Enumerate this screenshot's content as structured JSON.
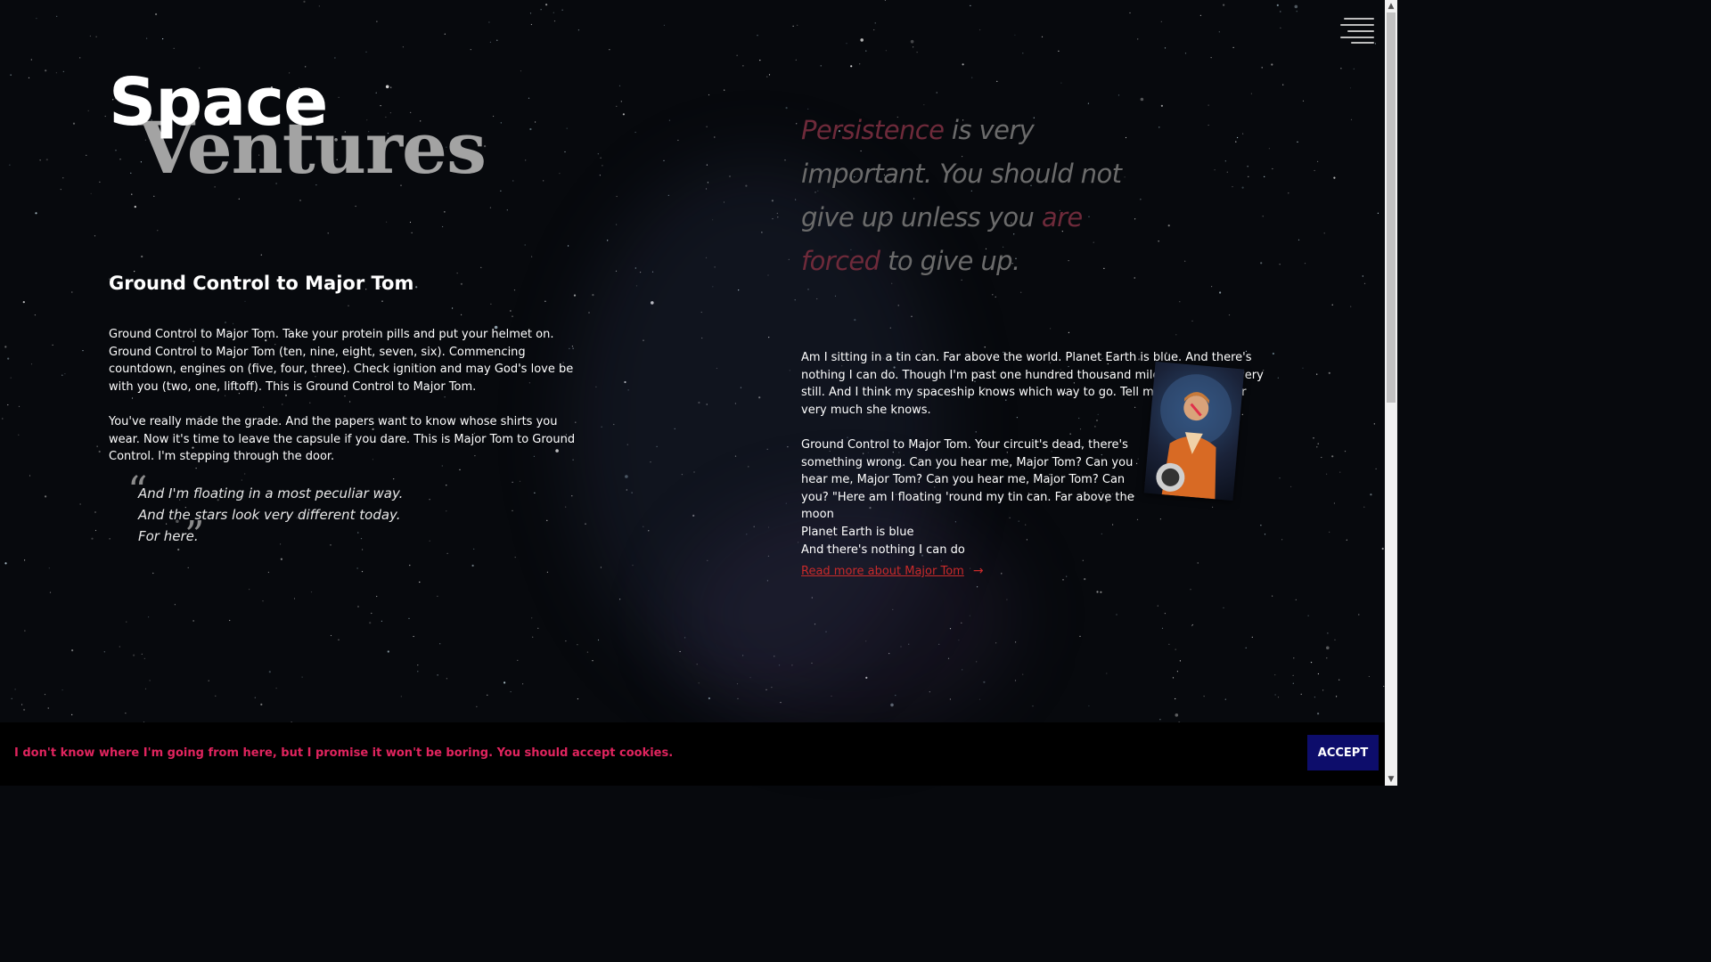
{
  "logo": {
    "word1": "Space",
    "word2": "Ventures"
  },
  "menu": {
    "icon": "hamburger-menu-icon"
  },
  "left": {
    "heading": "Ground Control to Major Tom",
    "paragraphs": [
      "Ground Control to Major Tom. Take your protein pills and put your helmet on. Ground Control to Major Tom (ten, nine, eight, seven, six). Commencing countdown, engines on (five, four, three). Check ignition and may God's love be with you (two, one, liftoff). This is Ground Control to Major Tom.",
      "You've really made the grade. And the papers want to know whose shirts you wear. Now it's time to leave the capsule if you dare. This is Major Tom to Ground Control. I'm stepping through the door."
    ],
    "quote": {
      "open_mark": "“",
      "close_mark": "”",
      "lines": [
        "And I'm floating in a most peculiar way.",
        "And the stars look very different today.",
        "For here."
      ]
    }
  },
  "right": {
    "big_quote": {
      "word1": "Persistence",
      "part2": " is very important. You should not give up unless you ",
      "word2": "are forced",
      "part3": " to give up."
    },
    "paragraph1": "Am I sitting in a tin can. Far above the world. Planet Earth is blue. And there's nothing I can do. Though I'm past one hundred thousand miles. I'm feeling very still. And I think my spaceship knows which way to go. Tell my wife I love her very much she knows.",
    "paragraph2": "Ground Control to Major Tom. Your circuit's dead, there's something wrong. Can you hear me, Major Tom? Can you hear me, Major Tom? Can you hear me, Major Tom? Can you? \"Here am I floating 'round my tin can. Far above the moon",
    "line3": "Planet Earth is blue",
    "line4": "And there's nothing I can do",
    "read_more": "Read more about Major Tom",
    "arrow": "→",
    "portrait_icon": "astronaut-portrait-image"
  },
  "cookie": {
    "message": "I don't know where I'm going from here, but I promise it won't be boring. You should accept cookies.",
    "accept": "ACCEPT"
  },
  "scrollbar": {
    "up": "▲",
    "down": "▼"
  },
  "colors": {
    "background": "#07090d",
    "accent_red": "#c92a2a",
    "cookie_text": "#e0245e",
    "accept_bg": "#0d0d6b",
    "quote_grey": "#6b6b6b",
    "quote_highlight": "#6e2a3a"
  }
}
